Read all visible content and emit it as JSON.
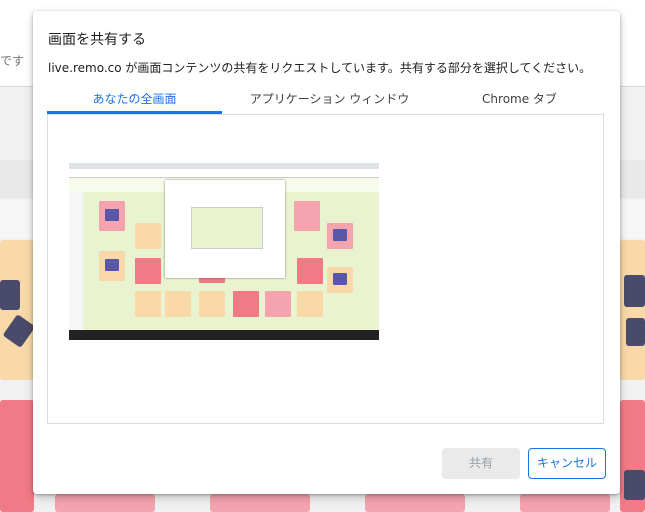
{
  "background": {
    "cut_text": "です"
  },
  "dialog": {
    "title": "画面を共有する",
    "description": "live.remo.co が画面コンテンツの共有をリクエストしています。共有する部分を選択してください。",
    "tabs": [
      {
        "label": "あなたの全画面",
        "active": true
      },
      {
        "label": "アプリケーション ウィンドウ",
        "active": false
      },
      {
        "label": "Chrome タブ",
        "active": false
      }
    ],
    "share_label": "共有",
    "cancel_label": "キャンセル"
  },
  "colors": {
    "accent": "#1a73e8",
    "disabled_bg": "#eaeaea",
    "disabled_text": "#9aa0a6"
  }
}
